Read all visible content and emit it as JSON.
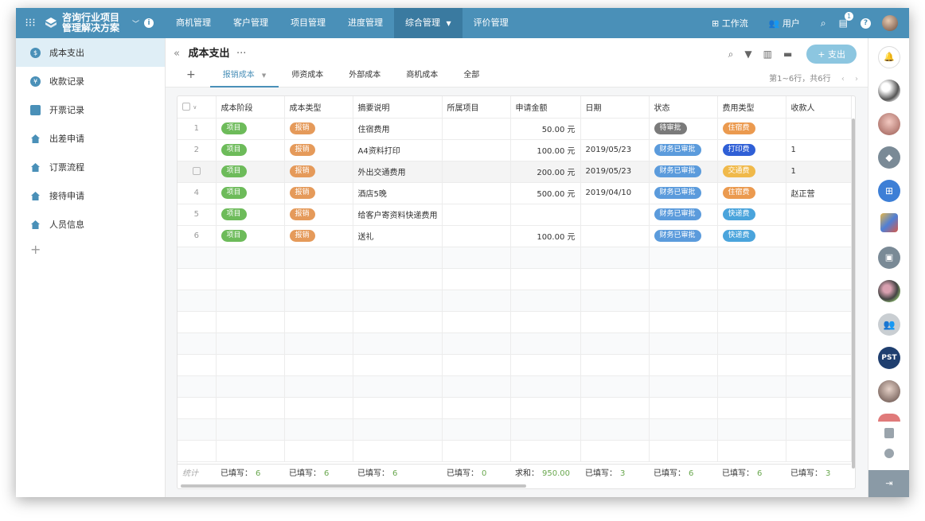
{
  "app": {
    "title_line1": "咨询行业项目",
    "title_line2": "管理解决方案",
    "nav": [
      "商机管理",
      "客户管理",
      "项目管理",
      "进度管理",
      "综合管理",
      "评价管理"
    ],
    "active_nav": 4,
    "workflow": "工作流",
    "users": "用户",
    "notification_count": "1",
    "help": "?"
  },
  "sidebar": {
    "items": [
      {
        "label": "成本支出",
        "icon": "dollar-icon"
      },
      {
        "label": "收款记录",
        "icon": "coin-icon"
      },
      {
        "label": "开票记录",
        "icon": "document-icon"
      },
      {
        "label": "出差申请",
        "icon": "house-icon"
      },
      {
        "label": "订票流程",
        "icon": "house-icon"
      },
      {
        "label": "接待申请",
        "icon": "house-icon"
      },
      {
        "label": "人员信息",
        "icon": "house-icon"
      }
    ],
    "add": "+"
  },
  "page": {
    "title": "成本支出",
    "back": "«",
    "more": "···",
    "add_button": "+ 支出",
    "tabs": [
      "报销成本",
      "师资成本",
      "外部成本",
      "商机成本",
      "全部"
    ],
    "pager": "第1~6行，共6行"
  },
  "table": {
    "columns": [
      "",
      "成本阶段",
      "成本类型",
      "摘要说明",
      "所属项目",
      "申请金额",
      "日期",
      "状态",
      "费用类型",
      "收款人"
    ],
    "rows": [
      {
        "idx": "1",
        "stage": "项目",
        "type": "报销",
        "summary": "住宿费用",
        "project": "",
        "amount": "50.00 元",
        "date": "",
        "status": "待审批",
        "fee": "住宿费",
        "payee": ""
      },
      {
        "idx": "2",
        "stage": "项目",
        "type": "报销",
        "summary": "A4资料打印",
        "project": "",
        "amount": "100.00 元",
        "date": "2019/05/23",
        "status": "财务已审批",
        "fee": "打印费",
        "payee": "1"
      },
      {
        "idx": "",
        "stage": "项目",
        "type": "报销",
        "summary": "外出交通费用",
        "project": "",
        "amount": "200.00 元",
        "date": "2019/05/23",
        "status": "财务已审批",
        "fee": "交通费",
        "payee": "1"
      },
      {
        "idx": "4",
        "stage": "项目",
        "type": "报销",
        "summary": "酒店5晚",
        "project": "",
        "amount": "500.00 元",
        "date": "2019/04/10",
        "status": "财务已审批",
        "fee": "住宿费",
        "payee": "赵正营"
      },
      {
        "idx": "5",
        "stage": "项目",
        "type": "报销",
        "summary": "给客户寄资料快递费用",
        "project": "",
        "amount": "",
        "date": "",
        "status": "财务已审批",
        "fee": "快递费",
        "payee": ""
      },
      {
        "idx": "6",
        "stage": "项目",
        "type": "报销",
        "summary": "送礼",
        "project": "",
        "amount": "100.00 元",
        "date": "",
        "status": "财务已审批",
        "fee": "快递费",
        "payee": ""
      }
    ],
    "footer": {
      "label": "统计",
      "cells": [
        {
          "text": "已填写：",
          "val": "6"
        },
        {
          "text": "已填写：",
          "val": "6"
        },
        {
          "text": "已填写：",
          "val": "6"
        },
        {
          "text": "已填写：",
          "val": "0"
        },
        {
          "text": "求和：",
          "val": "950.00"
        },
        {
          "text": "已填写：",
          "val": "3"
        },
        {
          "text": "已填写：",
          "val": "6"
        },
        {
          "text": "已填写：",
          "val": "6"
        },
        {
          "text": "已填写：",
          "val": "3"
        }
      ]
    }
  },
  "rail": {
    "pst": "PST"
  },
  "colors": {
    "header": "#4a90b8",
    "tag_green": "#6dbb5a",
    "tag_orange": "#e59a5a",
    "status_blue": "#5b9bdc",
    "status_gray": "#7a7a7a",
    "fee_orange": "#eb9a4f",
    "fee_blue": "#2f5fd6",
    "fee_yellow": "#f0b94a",
    "fee_cyan": "#4aa4dc"
  }
}
